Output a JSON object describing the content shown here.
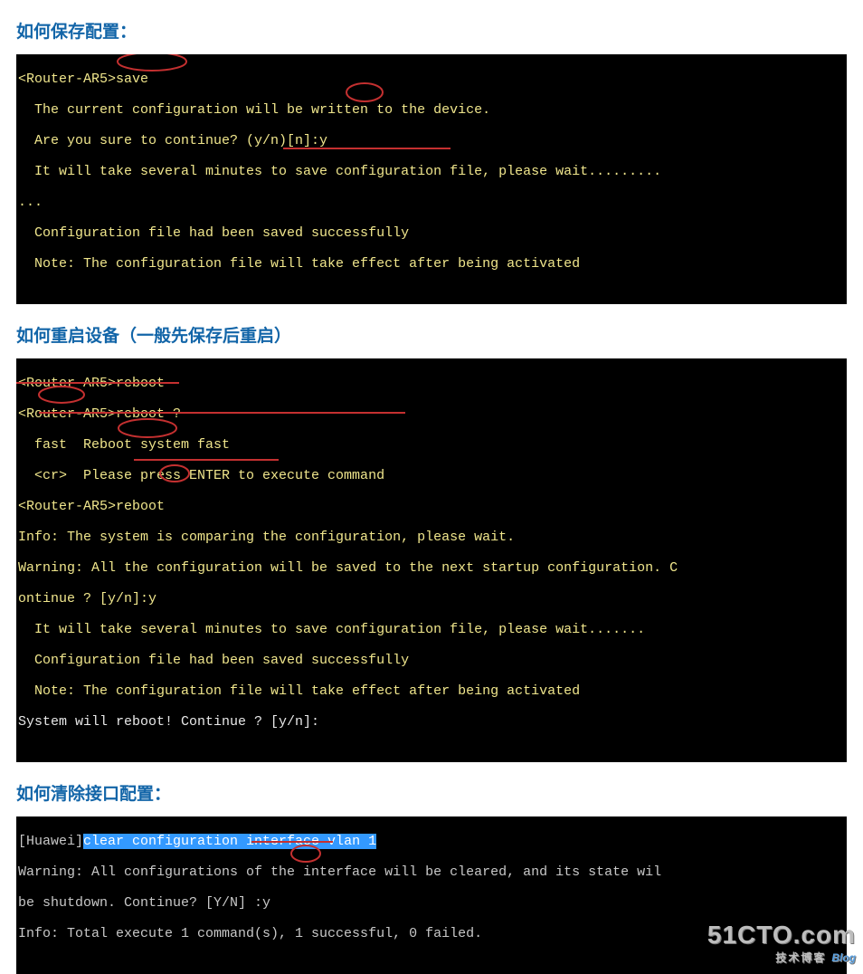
{
  "section1": {
    "heading": "如何保存配置：",
    "lines": {
      "l1": "<Router-AR5>save",
      "l2": "  The current configuration will be written to the device.",
      "l3": "  Are you sure to continue? (y/n)[n]:y",
      "l4": "  It will take several minutes to save configuration file, please wait.........",
      "l5": "...",
      "l6": "  Configuration file had been saved successfully",
      "l7": "  Note: The configuration file will take effect after being activated"
    }
  },
  "section2": {
    "heading": "如何重启设备（一般先保存后重启）",
    "lines": {
      "l1": "<Router-AR5>reboot",
      "l2": "<Router-AR5>reboot ?",
      "l3": "  fast  Reboot system fast",
      "l4": "  <cr>  Please press ENTER to execute command",
      "l5": "<Router-AR5>reboot",
      "l6": "Info: The system is comparing the configuration, please wait.",
      "l7": "Warning: All the configuration will be saved to the next startup configuration. C",
      "l8": "ontinue ? [y/n]:y",
      "l9": "  It will take several minutes to save configuration file, please wait.......",
      "l10": "  Configuration file had been saved successfully",
      "l11": "  Note: The configuration file will take effect after being activated",
      "l12": "System will reboot! Continue ? [y/n]:"
    }
  },
  "section3": {
    "heading": "如何清除接口配置：",
    "lines": {
      "l1a": "[Huawei]",
      "l1b": "clear configuration interface vlan 1",
      "l2": "Warning: All configurations of the interface will be cleared, and its state wil",
      "l3": "be shutdown. Continue? [Y/N] :y",
      "l4": "Info: Total execute 1 command(s), 1 successful, 0 failed."
    }
  },
  "watermark": {
    "main": "51CTO.com",
    "sub": "技术博客",
    "blog": "Blog"
  }
}
